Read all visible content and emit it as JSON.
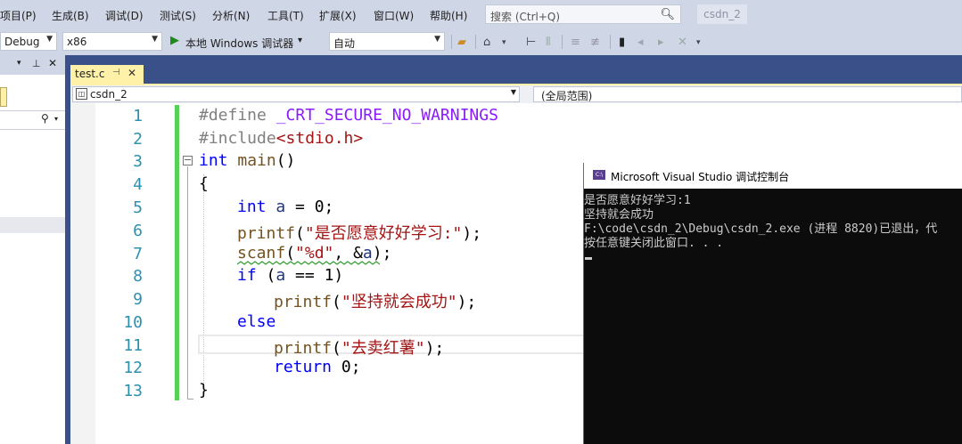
{
  "menubar": {
    "items": [
      "项目(P)",
      "生成(B)",
      "调试(D)",
      "测试(S)",
      "分析(N)",
      "工具(T)",
      "扩展(X)",
      "窗口(W)",
      "帮助(H)"
    ],
    "search_placeholder": "搜索 (Ctrl+Q)",
    "project_name": "csdn_2"
  },
  "toolbar": {
    "config": "Debug",
    "platform": "x86",
    "run_label": "本地 Windows 调试器",
    "run_arrow": "▾",
    "mode": "自动"
  },
  "tabs": [
    {
      "label": "test.c",
      "active": true
    }
  ],
  "navbar": {
    "file_scope": "csdn_2",
    "global_scope": "(全局范围)"
  },
  "editor": {
    "line_numbers": [
      "1",
      "2",
      "3",
      "4",
      "5",
      "6",
      "7",
      "8",
      "9",
      "10",
      "11",
      "12",
      "13"
    ],
    "lines": [
      "#define _CRT_SECURE_NO_WARNINGS",
      "#include<stdio.h>",
      "int main()",
      "{",
      "int a = 0;",
      "printf(\"是否愿意好好学习:\");",
      "scanf(\"%d\", &a);",
      "if (a == 1)",
      "printf(\"坚持就会成功\");",
      "else",
      "printf(\"去卖红薯\");",
      "return 0;",
      "}"
    ]
  },
  "console": {
    "title": "Microsoft Visual Studio 调试控制台",
    "icon_text": "C:\\",
    "output": [
      "是否愿意好好学习:1",
      "坚持就会成功",
      "F:\\code\\csdn_2\\Debug\\csdn_2.exe (进程 8820)已退出，代",
      "按任意键关闭此窗口. . ."
    ]
  },
  "colors": {
    "chrome": "#cfd6e5",
    "tab_strip": "#3a5089",
    "active_tab": "#fff2a8",
    "keyword": "#0000ff",
    "string": "#a31515",
    "line_number": "#2b91af",
    "change_bar": "#58d158",
    "console_bg": "#0c0c0c"
  }
}
